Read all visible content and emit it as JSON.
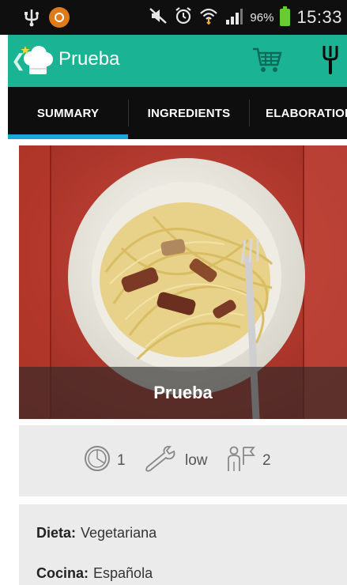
{
  "status_bar": {
    "icons": [
      "usb-icon",
      "app-notification-icon",
      "mute-icon",
      "alarm-icon",
      "wifi-icon",
      "signal-icon",
      "battery-icon"
    ],
    "battery_percent": "96%",
    "time": "15:33"
  },
  "action_bar": {
    "title": "Prueba",
    "color": "#1ab394",
    "icons": [
      "chef-hat-icon",
      "shopping-cart-icon",
      "fork-knife-icon"
    ]
  },
  "tabs": [
    {
      "label": "SUMMARY",
      "selected": true
    },
    {
      "label": "INGREDIENTS",
      "selected": false
    },
    {
      "label": "ELABORATION",
      "selected": false
    }
  ],
  "hero": {
    "caption": "Prueba"
  },
  "stats": {
    "time": "1",
    "difficulty": "low",
    "servings": "2"
  },
  "details": {
    "diet_label": "Dieta:",
    "diet_value": "Vegetariana",
    "cuisine_label": "Cocina:",
    "cuisine_value": "Española"
  }
}
